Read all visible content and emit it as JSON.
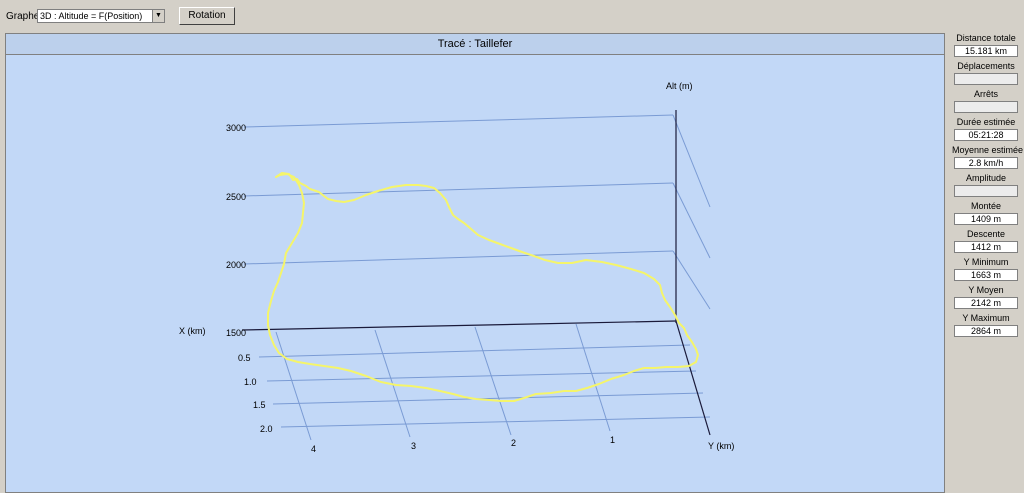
{
  "toolbar": {
    "graphe_label": "Graphe",
    "graph_type_value": "3D : Altitude = F(Position)",
    "rotation_button": "Rotation"
  },
  "graph": {
    "title": "Tracé : Taillefer",
    "axis_alt_label": "Alt (m)",
    "axis_x_label": "X (km)",
    "axis_y_label": "Y (km)",
    "alt_ticks": [
      "3000",
      "2500",
      "2000",
      "1500"
    ],
    "x_ticks": [
      "0.5",
      "1.0",
      "1.5",
      "2.0"
    ],
    "y_ticks": [
      "4",
      "3",
      "2",
      "1"
    ],
    "track_color": "#f5f56a",
    "background_color": "#c2d8f7",
    "grid_color": "#7a9bd4"
  },
  "stats": [
    {
      "label": "Distance totale",
      "value": "15.181 km"
    },
    {
      "label": "Déplacements",
      "value": ""
    },
    {
      "label": "Arrêts",
      "value": ""
    },
    {
      "label": "Durée estimée",
      "value": "05:21:28"
    },
    {
      "label": "Moyenne estimée",
      "value": "2.8 km/h"
    },
    {
      "label": "Amplitude",
      "value": ""
    },
    {
      "label": "Montée",
      "value": "1409 m"
    },
    {
      "label": "Descente",
      "value": "1412 m"
    },
    {
      "label": "Y Minimum",
      "value": "1663 m"
    },
    {
      "label": "Y Moyen",
      "value": "2142 m"
    },
    {
      "label": "Y Maximum",
      "value": "2864 m"
    }
  ]
}
